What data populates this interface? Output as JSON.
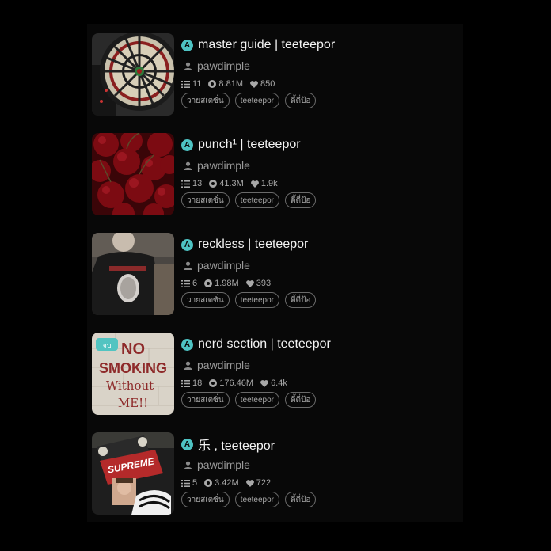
{
  "colors": {
    "background": "#000000",
    "accent_badge": "#4ec3c3",
    "title": "#f3f3f3",
    "muted": "#9a9a9a"
  },
  "icons": {
    "badge": "a-badge-icon",
    "author": "user-icon",
    "parts": "list-icon",
    "reads": "reads-icon",
    "votes": "heart-icon"
  },
  "stories": [
    {
      "badge": "A",
      "title": "master guide | teeteepor",
      "author": "pawdimple",
      "parts": "11",
      "reads": "8.81M",
      "votes": "850",
      "tags": [
        "วายสเตซั่น",
        "teeteepor",
        "ตี้ตี่ป้อ"
      ],
      "cover": "dartboard"
    },
    {
      "badge": "A",
      "title": "punch¹ | teeteepor",
      "author": "pawdimple",
      "parts": "13",
      "reads": "41.3M",
      "votes": "1.9k",
      "tags": [
        "วายสเตซั่น",
        "teeteepor",
        "ตี้ตี่ป้อ"
      ],
      "cover": "cherries"
    },
    {
      "badge": "A",
      "title": "reckless | teeteepor",
      "author": "pawdimple",
      "parts": "6",
      "reads": "1.98M",
      "votes": "393",
      "tags": [
        "วายสเตซั่น",
        "teeteepor",
        "ตี้ตี่ป้อ"
      ],
      "cover": "tshirt"
    },
    {
      "badge": "A",
      "title": "nerd section | teeteepor",
      "author": "pawdimple",
      "parts": "18",
      "reads": "176.46M",
      "votes": "6.4k",
      "tags": [
        "วายสเตซั่น",
        "teeteepor",
        "ตี้ตี่ป้อ"
      ],
      "cover": "nosmoking",
      "cover_badge": "จบ",
      "cover_text": [
        "NO",
        "SMOKING",
        "Without",
        "ME!!"
      ]
    },
    {
      "badge": "A",
      "title": "乐 , teeteepor",
      "author": "pawdimple",
      "parts": "5",
      "reads": "3.42M",
      "votes": "722",
      "tags": [
        "วายสเตซั่น",
        "teeteepor",
        "ตี้ตี่ป้อ"
      ],
      "cover": "skateboard",
      "cover_text": [
        "SUPREME"
      ]
    }
  ]
}
